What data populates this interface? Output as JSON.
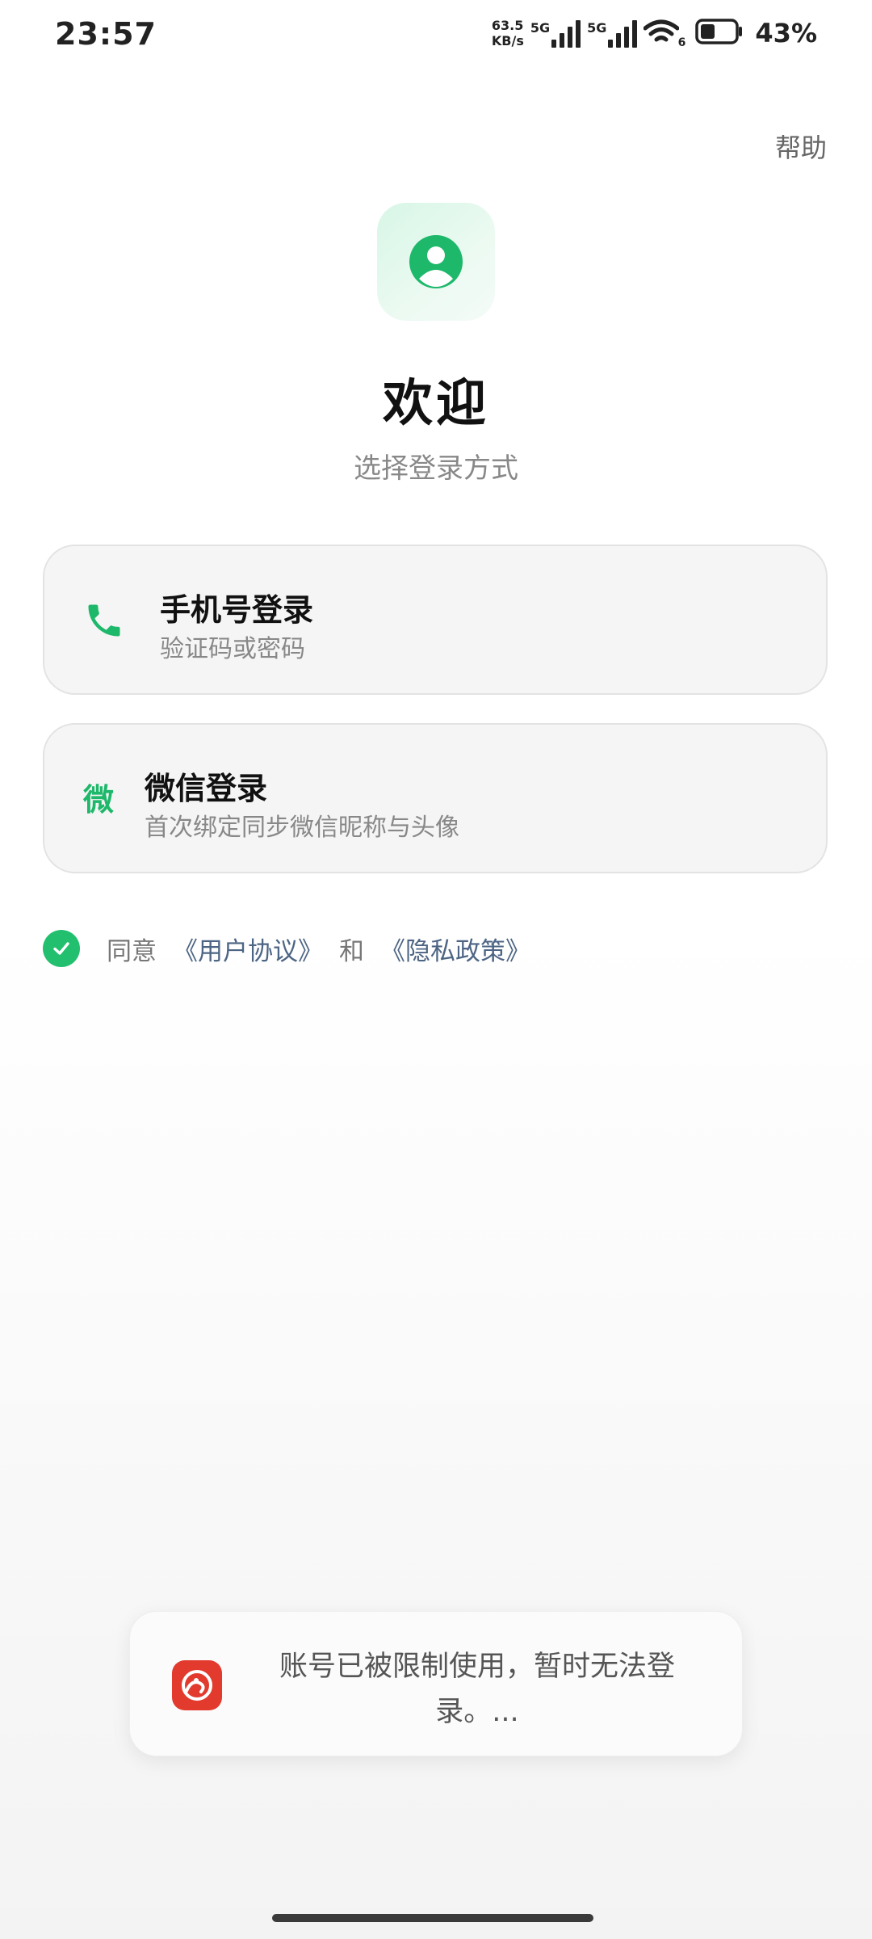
{
  "status_bar": {
    "time": "23:57",
    "net_speed_value": "63.5",
    "net_speed_unit": "KB/s",
    "sim1_label": "5G",
    "sim2_label": "5G",
    "wifi_badge": "6",
    "battery_percent": "43%",
    "battery_level": 0.43
  },
  "header": {
    "help_label": "帮助"
  },
  "welcome": {
    "title": "欢迎",
    "subtitle": "选择登录方式"
  },
  "login_options": {
    "phone": {
      "icon": "phone-icon",
      "title": "手机号登录",
      "subtitle": "验证码或密码"
    },
    "wechat": {
      "icon_text": "微",
      "title": "微信登录",
      "subtitle": "首次绑定同步微信昵称与头像"
    }
  },
  "agreement": {
    "checked": true,
    "prefix": "同意",
    "user_agreement": "《用户协议》",
    "conjunction": "和",
    "privacy_policy": "《隐私政策》"
  },
  "toast": {
    "message": "账号已被限制使用，暂时无法登录。..."
  },
  "colors": {
    "accent_green": "#22c06e",
    "link_blue": "#4d6584",
    "toast_icon_red": "#e23a2d"
  }
}
